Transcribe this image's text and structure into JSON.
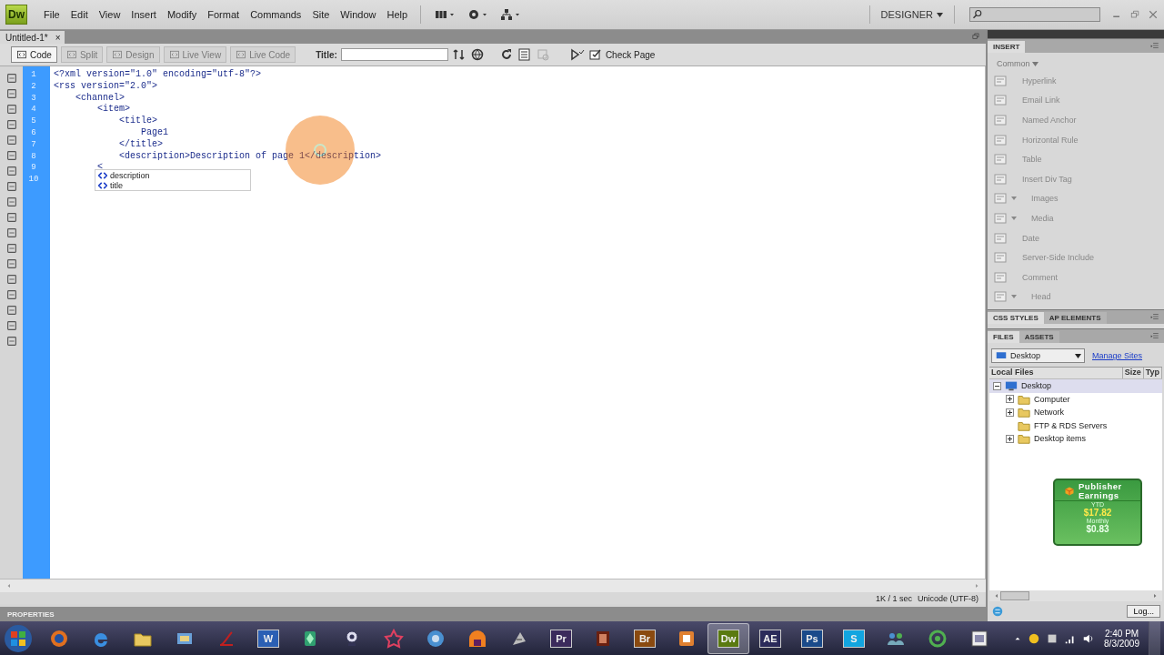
{
  "menubar": {
    "logo": "Dw",
    "menus": [
      "File",
      "Edit",
      "View",
      "Insert",
      "Modify",
      "Format",
      "Commands",
      "Site",
      "Window",
      "Help"
    ],
    "workspace": "DESIGNER"
  },
  "document_tab": {
    "title": "Untitled-1*",
    "close": "×"
  },
  "toolbar": {
    "view_buttons": [
      {
        "label": "Code",
        "selected": true,
        "disabled": false
      },
      {
        "label": "Split",
        "selected": false,
        "disabled": true
      },
      {
        "label": "Design",
        "selected": false,
        "disabled": true
      },
      {
        "label": "Live View",
        "selected": false,
        "disabled": true
      },
      {
        "label": "Live Code",
        "selected": false,
        "disabled": true
      }
    ],
    "title_label": "Title:",
    "check_page": "Check Page"
  },
  "editor": {
    "lines": [
      {
        "number": "1",
        "text": "<?xml version=\"1.0\" encoding=\"utf-8\"?>"
      },
      {
        "number": "2",
        "text": "<rss version=\"2.0\">"
      },
      {
        "number": "3",
        "text": "    <channel>"
      },
      {
        "number": "4",
        "text": "        <item>"
      },
      {
        "number": "5",
        "text": "            <title>"
      },
      {
        "number": "6",
        "text": "                Page1"
      },
      {
        "number": "7",
        "text": "            </title>"
      },
      {
        "number": "8",
        "text": "            <description>Description of page 1</description>"
      },
      {
        "number": "9",
        "text": "        <"
      },
      {
        "number": "10"
      }
    ],
    "hints": [
      "description",
      "title"
    ]
  },
  "status_bar": {
    "size": "1K / 1 sec",
    "encoding": "Unicode (UTF-8)"
  },
  "properties": {
    "title": "PROPERTIES"
  },
  "insert_panel": {
    "tabs": [
      {
        "label": "INSERT",
        "selected": true
      }
    ],
    "category": "Common",
    "items": [
      {
        "label": "Hyperlink",
        "kind": "plain"
      },
      {
        "label": "Email Link",
        "kind": "plain"
      },
      {
        "label": "Named Anchor",
        "kind": "plain"
      },
      {
        "label": "Horizontal Rule",
        "kind": "plain"
      },
      {
        "label": "Table",
        "kind": "plain"
      },
      {
        "label": "Insert Div Tag",
        "kind": "plain"
      },
      {
        "label": "Images",
        "kind": "menu"
      },
      {
        "label": "Media",
        "kind": "menu"
      },
      {
        "label": "Date",
        "kind": "plain"
      },
      {
        "label": "Server-Side Include",
        "kind": "plain"
      },
      {
        "label": "Comment",
        "kind": "plain"
      },
      {
        "label": "Head",
        "kind": "menu"
      }
    ]
  },
  "css_panel": {
    "tabs": [
      {
        "label": "CSS STYLES",
        "selected": true
      },
      {
        "label": "AP ELEMENTS",
        "selected": false
      }
    ]
  },
  "files_panel": {
    "tabs": [
      {
        "label": "FILES",
        "selected": true
      },
      {
        "label": "ASSETS",
        "selected": false
      }
    ],
    "site": "Desktop",
    "manage": "Manage Sites",
    "columns": [
      "Local Files",
      "Size",
      "Typ"
    ],
    "tree": [
      {
        "label": "Desktop",
        "expanded": true,
        "children": [
          {
            "label": "Computer",
            "expanded": false
          },
          {
            "label": "Network",
            "expanded": false
          },
          {
            "label": "FTP & RDS Servers"
          },
          {
            "label": "Desktop items",
            "expanded": false
          }
        ]
      }
    ],
    "log_button": "Log..."
  },
  "gadget": {
    "title": "Publisher Earnings",
    "ytd_label": "YTD",
    "ytd": "$17.82",
    "monthly_label": "Monthly",
    "monthly": "$0.83"
  },
  "taskbar": {
    "apps": [
      {
        "kind": "icon",
        "selected": false
      },
      {
        "kind": "icon",
        "selected": false
      },
      {
        "kind": "icon",
        "selected": false
      },
      {
        "kind": "icon",
        "selected": false
      },
      {
        "kind": "icon",
        "selected": false
      },
      {
        "kind": "text",
        "label": "W",
        "color": "#2b5fb4",
        "selected": false
      },
      {
        "kind": "icon",
        "selected": false
      },
      {
        "kind": "icon",
        "selected": false
      },
      {
        "kind": "icon",
        "selected": false
      },
      {
        "kind": "icon",
        "selected": false
      },
      {
        "kind": "icon",
        "selected": false
      },
      {
        "kind": "icon",
        "selected": false
      },
      {
        "kind": "text",
        "label": "Pr",
        "color": "#3b2a5c",
        "selected": false
      },
      {
        "kind": "icon",
        "selected": false
      },
      {
        "kind": "text",
        "label": "Br",
        "color": "#8a4a10",
        "selected": false
      },
      {
        "kind": "icon",
        "selected": false
      },
      {
        "kind": "text",
        "label": "Dw",
        "color": "#5a7a10",
        "selected": true
      },
      {
        "kind": "text",
        "label": "AE",
        "color": "#2a2a5a",
        "selected": false
      },
      {
        "kind": "text",
        "label": "Ps",
        "color": "#1a4a8a",
        "selected": false
      },
      {
        "kind": "text",
        "label": "S",
        "color": "#12a5e0",
        "selected": false
      },
      {
        "kind": "icon",
        "selected": false
      },
      {
        "kind": "icon",
        "selected": false
      },
      {
        "kind": "icon",
        "selected": false
      }
    ],
    "time": "2:40 PM",
    "date": "8/3/2009"
  }
}
